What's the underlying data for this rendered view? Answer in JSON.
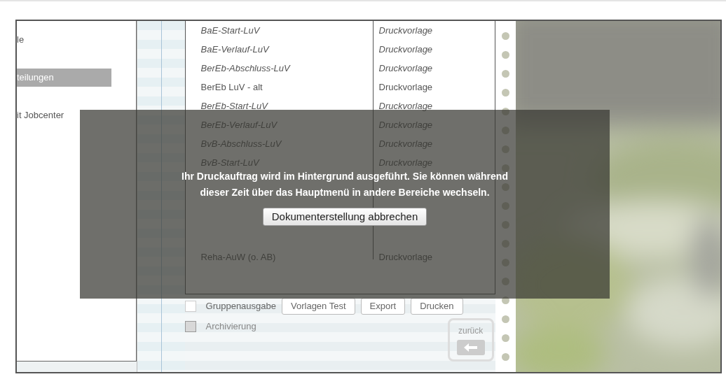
{
  "sidebar": {
    "items": [
      {
        "label": "le",
        "selected": false
      },
      {
        "label": "teilungen",
        "selected": true
      },
      {
        "label": "it Jobcenter",
        "selected": false
      }
    ]
  },
  "templates": {
    "rows": [
      {
        "name": "BaE-Start-LuV",
        "type": "Druckvorlage",
        "italic": true
      },
      {
        "name": "BaE-Verlauf-LuV",
        "type": "Druckvorlage",
        "italic": true
      },
      {
        "name": "BerEb-Abschluss-LuV",
        "type": "Druckvorlage",
        "italic": true
      },
      {
        "name": "BerEb LuV - alt",
        "type": "Druckvorlage",
        "italic": false
      },
      {
        "name": "BerEb-Start-LuV",
        "type": "Druckvorlage",
        "italic": true
      },
      {
        "name": "BerEb-Verlauf-LuV",
        "type": "Druckvorlage",
        "italic": true
      },
      {
        "name": "BvB-Abschluss-LuV",
        "type": "Druckvorlage",
        "italic": true
      },
      {
        "name": "BvB-Start-LuV",
        "type": "Druckvorlage",
        "italic": true
      }
    ],
    "rows_below_message": [
      {
        "name": "Reha-AuW (o. AB)",
        "type": "Druckvorlage",
        "italic": false
      }
    ]
  },
  "options": [
    {
      "label": "Gruppenausgabe",
      "checked": false,
      "disabled": false
    },
    {
      "label": "Archivierung",
      "checked": false,
      "disabled": true
    }
  ],
  "buttons": [
    "Vorlagen Test",
    "Export",
    "Drucken"
  ],
  "back_button": {
    "label": "zurück"
  },
  "dialog": {
    "message": "Ihr Druckauftrag wird im Hintergrund ausgeführt. Sie können während\ndieser Zeit über das Hauptmenü in andere Bereiche wechseln.",
    "button": "Dokumenterstellung abbrechen"
  }
}
